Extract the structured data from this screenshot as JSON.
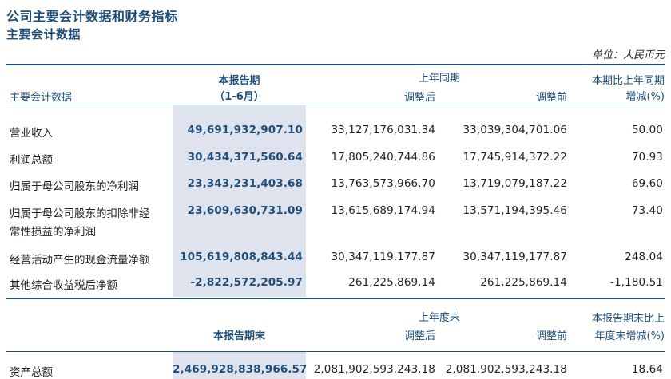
{
  "title": "公司主要会计数据和财务指标",
  "subtitle": "主要会计数据",
  "unit": "单位：人民币元",
  "headers": {
    "item": "主要会计数据",
    "current_line1": "本报告期",
    "current_line2": "（1-6月）",
    "prior_group": "上年同期",
    "adjusted_after": "调整后",
    "adjusted_before": "调整前",
    "change_line1": "本期比上年同期",
    "change_line2": "增减(%)"
  },
  "rows": [
    {
      "label_line1": "营业收入",
      "label_line2": "",
      "current": "49,691,932,907.10",
      "after": "33,127,176,031.34",
      "before": "33,039,304,701.06",
      "change": "50.00"
    },
    {
      "label_line1": "利润总额",
      "label_line2": "",
      "current": "30,434,371,560.64",
      "after": "17,805,240,744.86",
      "before": "17,745,914,372.22",
      "change": "70.93"
    },
    {
      "label_line1": "归属于母公司股东的净利润",
      "label_line2": "",
      "current": "23,343,231,403.68",
      "after": "13,763,573,966.70",
      "before": "13,719,079,187.22",
      "change": "69.60"
    },
    {
      "label_line1": "归属于母公司股东的扣除非经",
      "label_line2": "常性损益的净利润",
      "current": "23,609,630,731.09",
      "after": "13,615,689,174.94",
      "before": "13,571,194,395.46",
      "change": "73.40"
    },
    {
      "label_line1": "经营活动产生的现金流量净额",
      "label_line2": "",
      "current": "105,619,808,843.44",
      "after": "30,347,119,177.87",
      "before": "30,347,119,177.87",
      "change": "248.04"
    },
    {
      "label_line1": "其他综合收益税后净额",
      "label_line2": "",
      "current": "-2,822,572,205.97",
      "after": "261,225,869.14",
      "before": "261,225,869.14",
      "change": "-1,180.51"
    }
  ],
  "headers2": {
    "current": "本报告期末",
    "prior_group": "上年度末",
    "adjusted_after": "调整后",
    "adjusted_before": "调整前",
    "change_line1": "本报告期末比上",
    "change_line2": "年度末增减(%)"
  },
  "rows2": [
    {
      "label_line1": "资产总额",
      "current": "2,469,928,838,966.57",
      "after": "2,081,902,593,243.18",
      "before": "2,081,902,593,243.18",
      "change": "18.64"
    }
  ]
}
